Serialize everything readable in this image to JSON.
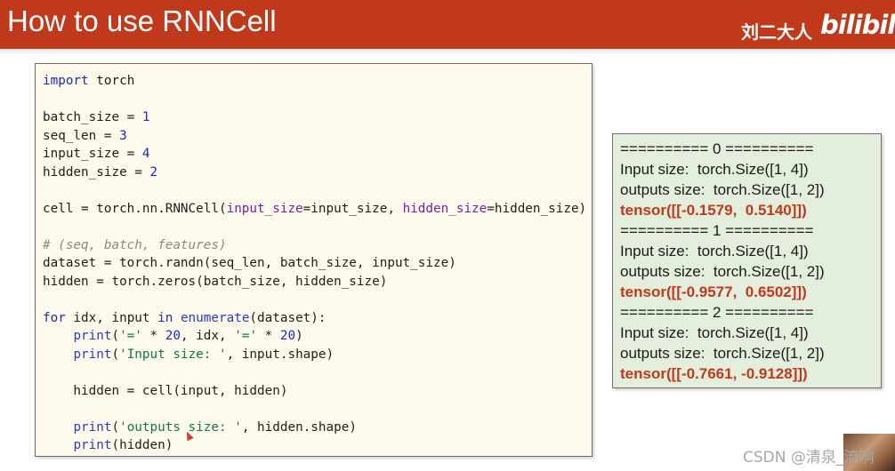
{
  "header": {
    "title": "How to use RNNCell",
    "brand_text": "刘二大人",
    "brand_logo": "bilibili",
    "colors": {
      "background": "#c0391b",
      "text": "#ffffff"
    }
  },
  "code_panel": {
    "background": "#fefaeb",
    "lines": [
      [
        {
          "t": "import",
          "c": "kw"
        },
        {
          "t": " torch"
        }
      ],
      [],
      [
        {
          "t": "batch_size = "
        },
        {
          "t": "1",
          "c": "num"
        }
      ],
      [
        {
          "t": "seq_len = "
        },
        {
          "t": "3",
          "c": "num"
        }
      ],
      [
        {
          "t": "input_size = "
        },
        {
          "t": "4",
          "c": "num"
        }
      ],
      [
        {
          "t": "hidden_size = "
        },
        {
          "t": "2",
          "c": "num"
        }
      ],
      [],
      [
        {
          "t": "cell = torch.nn.RNNCell("
        },
        {
          "t": "input_size",
          "c": "kwarg"
        },
        {
          "t": "=input_size, "
        },
        {
          "t": "hidden_size",
          "c": "kwarg"
        },
        {
          "t": "=hidden_size)"
        }
      ],
      [],
      [
        {
          "t": "# (seq, batch, features)",
          "c": "cm"
        }
      ],
      [
        {
          "t": "dataset = torch.randn(seq_len, batch_size, input_size)"
        }
      ],
      [
        {
          "t": "hidden = torch.zeros(batch_size, hidden_size)"
        }
      ],
      [],
      [
        {
          "t": "for",
          "c": "kw"
        },
        {
          "t": " idx, input "
        },
        {
          "t": "in",
          "c": "kw"
        },
        {
          "t": " "
        },
        {
          "t": "enumerate",
          "c": "bi"
        },
        {
          "t": "(dataset):"
        }
      ],
      [
        {
          "t": "    "
        },
        {
          "t": "print",
          "c": "bi"
        },
        {
          "t": "("
        },
        {
          "t": "'='",
          "c": "str"
        },
        {
          "t": " * "
        },
        {
          "t": "20",
          "c": "num"
        },
        {
          "t": ", idx, "
        },
        {
          "t": "'='",
          "c": "str"
        },
        {
          "t": " * "
        },
        {
          "t": "20",
          "c": "num"
        },
        {
          "t": ")"
        }
      ],
      [
        {
          "t": "    "
        },
        {
          "t": "print",
          "c": "bi"
        },
        {
          "t": "("
        },
        {
          "t": "'Input size: '",
          "c": "str"
        },
        {
          "t": ", input.shape)"
        }
      ],
      [],
      [
        {
          "t": "    hidden = cell(input, hidden)"
        }
      ],
      [],
      [
        {
          "t": "    "
        },
        {
          "t": "print",
          "c": "bi"
        },
        {
          "t": "("
        },
        {
          "t": "'outputs size: '",
          "c": "str"
        },
        {
          "t": ", hidden.shape)"
        }
      ],
      [
        {
          "t": "    "
        },
        {
          "t": "print",
          "c": "bi"
        },
        {
          "t": "(hidden)"
        }
      ]
    ]
  },
  "output_panel": {
    "background": "#e3eedd",
    "lines": [
      {
        "text": "========== 0 ==========",
        "tensor": false
      },
      {
        "text": "Input size:  torch.Size([1, 4])",
        "tensor": false
      },
      {
        "text": "outputs size:  torch.Size([1, 2])",
        "tensor": false
      },
      {
        "text": "tensor([[-0.1579,  0.5140]])",
        "tensor": true
      },
      {
        "text": "========== 1 ==========",
        "tensor": false
      },
      {
        "text": "Input size:  torch.Size([1, 4])",
        "tensor": false
      },
      {
        "text": "outputs size:  torch.Size([1, 2])",
        "tensor": false
      },
      {
        "text": "tensor([[-0.9577,  0.6502]])",
        "tensor": true
      },
      {
        "text": "========== 2 ==========",
        "tensor": false
      },
      {
        "text": "Input size:  torch.Size([1, 4])",
        "tensor": false
      },
      {
        "text": "outputs size:  torch.Size([1, 2])",
        "tensor": false
      },
      {
        "text": "tensor([[-0.7661, -0.9128]])",
        "tensor": true
      }
    ],
    "tensor_color": "#c0391b"
  },
  "watermark": "CSDN @清泉_流响"
}
